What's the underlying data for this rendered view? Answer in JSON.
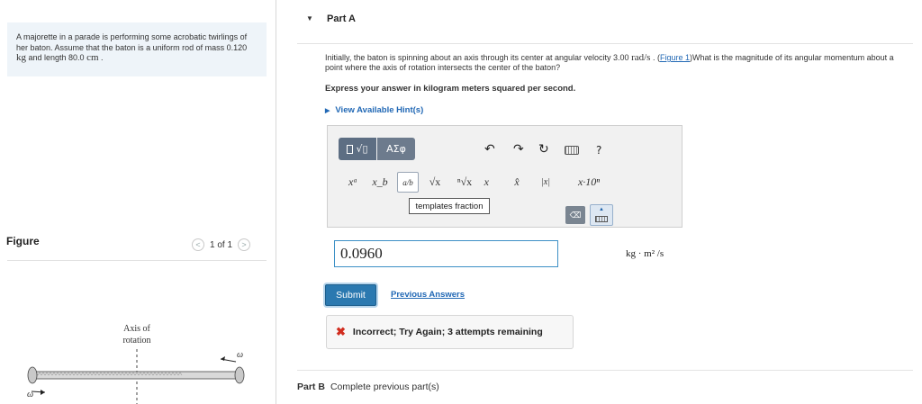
{
  "problem": {
    "text_1": "A majorette in a parade is performing some acrobatic twirlings of her baton. Assume that the baton is a uniform rod of mass ",
    "mass_value": "0.120",
    "mass_unit": "kg",
    "text_2": " and length ",
    "length_value": "80.0",
    "length_unit": "cm",
    "text_end": " ."
  },
  "figure": {
    "label": "Figure",
    "pager_text": "1 of 1",
    "prev_glyph": "<",
    "next_glyph": ">",
    "axis_label_line1": "Axis of",
    "axis_label_line2": "rotation",
    "omega": "ω"
  },
  "part_a": {
    "title": "Part A",
    "question_1": "Initially, the baton is spinning about an axis through its center at angular velocity ",
    "omega_value": "3.00",
    "omega_unit": "rad/s",
    "question_2": " . (",
    "figure_link": "Figure 1",
    "question_3": ")What is the magnitude of its angular momentum about a point where the axis of rotation intersects the center of the baton?",
    "instruction": "Express your answer in kilogram meters squared per second.",
    "hints_label": "View Available Hint(s)",
    "toolbar": {
      "greek_label": "ΑΣφ",
      "undo": "↶",
      "redo": "↷",
      "reset": "↻",
      "help": "?"
    },
    "templates": {
      "superscript": "xᵃ",
      "subscript": "x_b",
      "fraction": "a/b",
      "sqrt": "√x",
      "nthroot": "ⁿ√x",
      "vector": "x⃗",
      "hat": "x̂",
      "abs": "|x|",
      "sci": "x·10ⁿ"
    },
    "tooltip": "templates fraction",
    "answer_value": "0.0960",
    "units": "kg · m² /s",
    "submit_label": "Submit",
    "previous_answers": "Previous Answers",
    "feedback": "Incorrect; Try Again; 3 attempts remaining"
  },
  "part_b": {
    "title": "Part B",
    "text": "Complete previous part(s)"
  }
}
